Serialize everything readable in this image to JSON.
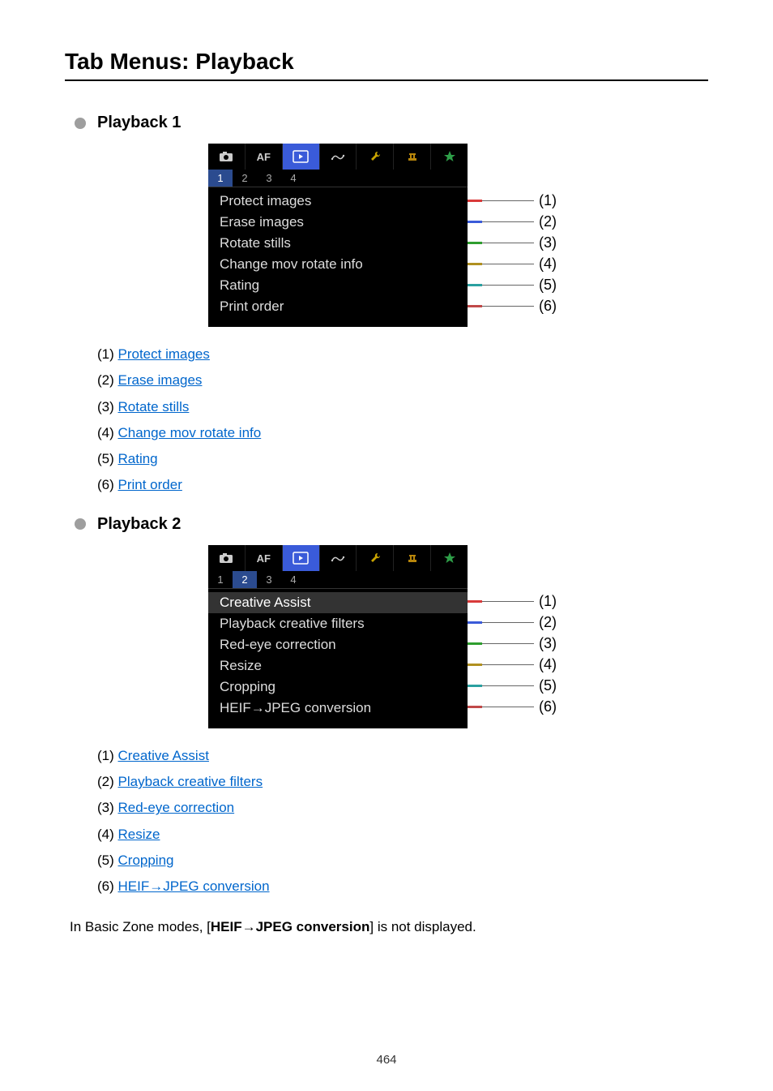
{
  "title": "Tab Menus: Playback",
  "sections": [
    {
      "heading": "Playback 1",
      "activeSubTab": "1",
      "subTabs": [
        "1",
        "2",
        "3",
        "4"
      ],
      "menuItems": [
        "Protect images",
        "Erase images",
        "Rotate stills",
        "Change mov rotate info",
        "Rating",
        "Print order"
      ],
      "highlightIndex": -1,
      "links": [
        {
          "n": "(1)",
          "label": "Protect images"
        },
        {
          "n": "(2)",
          "label": "Erase images"
        },
        {
          "n": "(3)",
          "label": "Rotate stills"
        },
        {
          "n": "(4)",
          "label": "Change mov rotate info"
        },
        {
          "n": "(5)",
          "label": "Rating"
        },
        {
          "n": "(6)",
          "label": "Print order"
        }
      ]
    },
    {
      "heading": "Playback 2",
      "activeSubTab": "2",
      "subTabs": [
        "1",
        "2",
        "3",
        "4"
      ],
      "menuItems": [
        "Creative Assist",
        "Playback creative filters",
        "Red-eye correction",
        "Resize",
        "Cropping",
        "HEIF→JPEG conversion"
      ],
      "highlightIndex": 0,
      "links": [
        {
          "n": "(1)",
          "label": "Creative Assist"
        },
        {
          "n": "(2)",
          "label": "Playback creative filters"
        },
        {
          "n": "(3)",
          "label": "Red-eye correction"
        },
        {
          "n": "(4)",
          "label": "Resize"
        },
        {
          "n": "(5)",
          "label": "Cropping"
        },
        {
          "n": "(6)",
          "label": "HEIF→JPEG conversion"
        }
      ]
    }
  ],
  "note_prefix": "In Basic Zone modes, [",
  "note_bold": "HEIF→JPEG conversion",
  "note_suffix": "] is not displayed.",
  "pageNumber": "464",
  "tickColors": [
    "#d93a3a",
    "#3a5bd9",
    "#2e9e2e",
    "#b09020",
    "#2aa0a0",
    "#c04848"
  ],
  "afLabel": "AF"
}
